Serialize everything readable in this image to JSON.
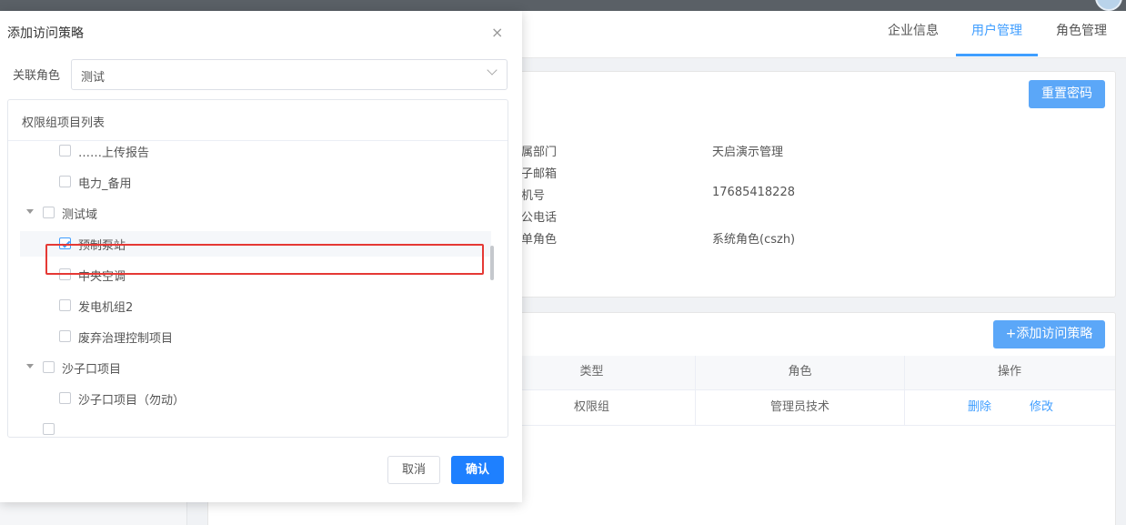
{
  "header": {
    "tabs": [
      {
        "label": "企业信息",
        "active": false
      },
      {
        "label": "用户管理",
        "active": true
      },
      {
        "label": "角色管理",
        "active": false
      }
    ]
  },
  "user_info": {
    "reset_password_label": "重置密码",
    "fields": [
      {
        "label": "属部门",
        "value": "天启演示管理"
      },
      {
        "label": "子邮箱",
        "value": ""
      },
      {
        "label": "机号",
        "value": "17685418228"
      },
      {
        "label": "公电话",
        "value": ""
      },
      {
        "label": "单角色",
        "value": "系统角色(cszh)"
      }
    ]
  },
  "policy_table": {
    "add_button_label": "+添加访问策略",
    "columns": [
      "类型",
      "角色",
      "操作"
    ],
    "rows": [
      {
        "type": "权限组",
        "role": "管理员技术",
        "delete_label": "删除",
        "edit_label": "修改"
      }
    ]
  },
  "dialog": {
    "title": "添加访问策略",
    "close_glyph": "×",
    "role_field_label": "关联角色",
    "role_selected": "测试",
    "tree_title": "权限组项目列表",
    "tree_items": [
      {
        "label": "……上传报告",
        "level": 2,
        "checked": false
      },
      {
        "label": "电力_备用",
        "level": 2,
        "checked": false
      },
      {
        "label": "测试域",
        "level": 1,
        "checked": false,
        "expanded": true
      },
      {
        "label": "预制泵站",
        "level": 2,
        "checked": true
      },
      {
        "label": "中央空调",
        "level": 2,
        "checked": false
      },
      {
        "label": "发电机组2",
        "level": 2,
        "checked": false
      },
      {
        "label": "废弃治理控制项目",
        "level": 2,
        "checked": false
      },
      {
        "label": "沙子口项目",
        "level": 1,
        "checked": false,
        "expanded": true
      },
      {
        "label": "沙子口项目（勿动）",
        "level": 2,
        "checked": false
      },
      {
        "label": "",
        "level": 1,
        "checked": false
      }
    ],
    "cancel_label": "取消",
    "confirm_label": "确认"
  },
  "colors": {
    "accent": "#409eff",
    "confirm_button": "#1e80ff",
    "highlight_box": "#e53935"
  }
}
